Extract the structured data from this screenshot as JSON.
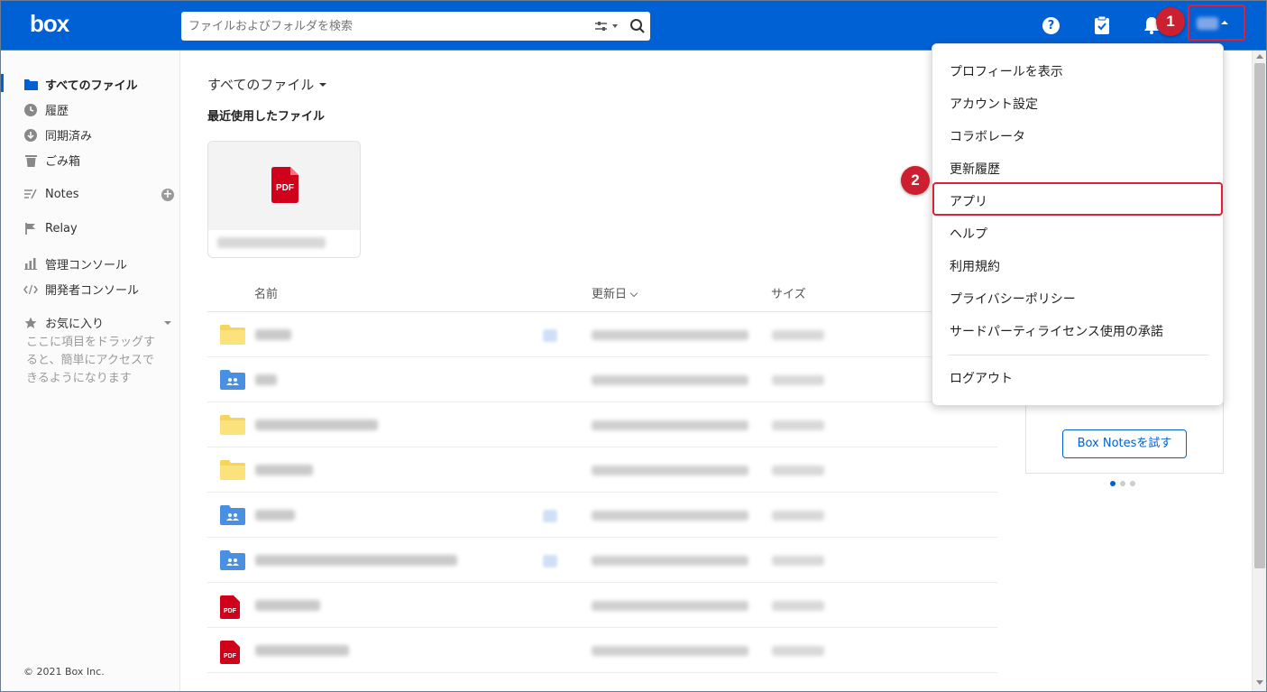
{
  "header": {
    "logo": "box",
    "search_placeholder": "ファイルおよびフォルダを検索",
    "icons": [
      "filter-icon",
      "search-icon",
      "help-icon",
      "tasks-icon",
      "bell-icon"
    ],
    "help_glyph": "?"
  },
  "annotations": {
    "badge1": "1",
    "badge2": "2",
    "highlight_color": "#e0203a"
  },
  "sidebar": {
    "items": [
      {
        "label": "すべてのファイル",
        "icon": "folder-icon",
        "active": true
      },
      {
        "label": "履歴",
        "icon": "clock-icon"
      },
      {
        "label": "同期済み",
        "icon": "sync-icon"
      },
      {
        "label": "ごみ箱",
        "icon": "trash-icon"
      },
      {
        "label": "Notes",
        "icon": "notes-icon"
      },
      {
        "label": "Relay",
        "icon": "relay-icon"
      },
      {
        "label": "管理コンソール",
        "icon": "chart-icon"
      },
      {
        "label": "開発者コンソール",
        "icon": "code-icon"
      },
      {
        "label": "お気に入り",
        "icon": "star-icon"
      }
    ],
    "notes_add": "+",
    "favorites_hint": "ここに項目をドラッグすると、簡単にアクセスできるようになります",
    "copyright": "© 2021 Box Inc."
  },
  "main": {
    "breadcrumb": "すべてのファイル",
    "recent_title": "最近使用したファイル",
    "recent_card_icon": "PDF",
    "columns": {
      "name": "名前",
      "updated": "更新日",
      "size": "サイズ"
    },
    "rows": [
      {
        "type": "folder"
      },
      {
        "type": "shared-folder"
      },
      {
        "type": "folder"
      },
      {
        "type": "folder"
      },
      {
        "type": "shared-folder"
      },
      {
        "type": "shared-folder"
      },
      {
        "type": "pdf"
      },
      {
        "type": "pdf"
      }
    ]
  },
  "dropdown": {
    "items": [
      "プロフィールを表示",
      "アカウント設定",
      "コラボレータ",
      "更新履歴",
      "アプリ",
      "ヘルプ",
      "利用規約",
      "プライバシーポリシー",
      "サードパーティライセンス使用の承諾",
      "ログアウト"
    ]
  },
  "right_panel": {
    "button": "Box Notesを試す"
  },
  "colors": {
    "brand": "#0061d5",
    "folder_yellow": "#f7d45b",
    "folder_blue": "#4a90e2",
    "pdf_red": "#d0021b"
  }
}
